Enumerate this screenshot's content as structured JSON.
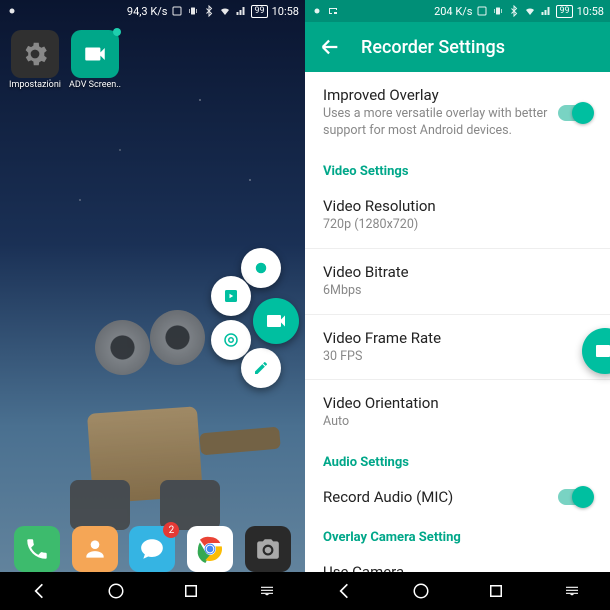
{
  "left": {
    "status": {
      "speed": "94,3 K/s",
      "battery": "99",
      "time": "10:58"
    },
    "apps": [
      {
        "label": "Impostazioni"
      },
      {
        "label": "ADV Screen.."
      }
    ],
    "dock_badge": "2"
  },
  "right": {
    "status": {
      "speed": "204 K/s",
      "battery": "99",
      "time": "10:58"
    },
    "title": "Recorder Settings",
    "improved": {
      "title": "Improved Overlay",
      "sub": "Uses a more versatile overlay with better support for most Android devices."
    },
    "section_video": "Video Settings",
    "resolution": {
      "title": "Video Resolution",
      "sub": "720p (1280x720)"
    },
    "bitrate": {
      "title": "Video Bitrate",
      "sub": "6Mbps"
    },
    "framerate": {
      "title": "Video Frame Rate",
      "sub": "30 FPS"
    },
    "orientation": {
      "title": "Video Orientation",
      "sub": "Auto"
    },
    "section_audio": "Audio Settings",
    "record_audio": {
      "title": "Record Audio (MIC)"
    },
    "section_camera": "Overlay Camera Setting",
    "use_camera": {
      "title": "Use Camera"
    }
  }
}
